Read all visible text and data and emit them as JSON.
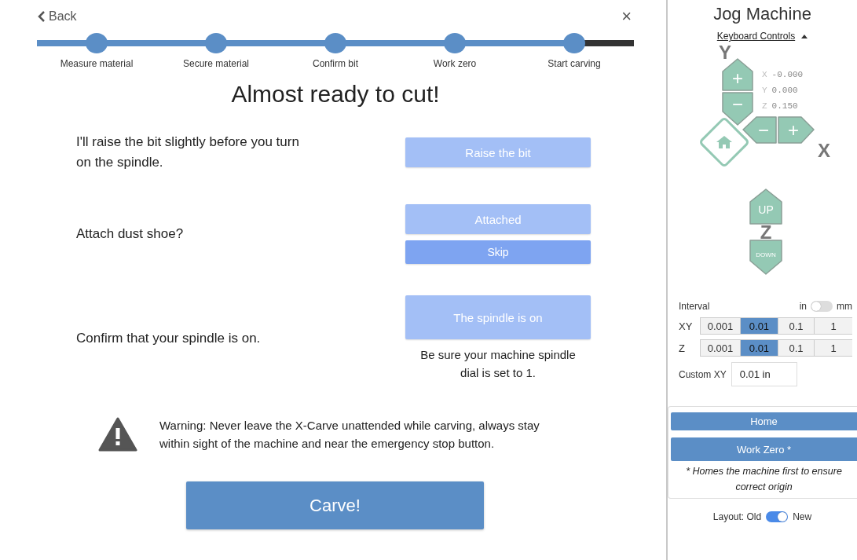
{
  "header": {
    "back": "Back",
    "close": "×"
  },
  "progress": {
    "level": 0.9
  },
  "steps": [
    {
      "label": "Measure material"
    },
    {
      "label": "Secure material"
    },
    {
      "label": "Confirm bit"
    },
    {
      "label": "Work zero"
    },
    {
      "label": "Start carving"
    }
  ],
  "title": "Almost ready to cut!",
  "tasks": [
    {
      "text": "I'll raise the bit slightly before you turn on the spindle.",
      "buttons": [
        {
          "label": "Raise the bit",
          "kind": "light"
        }
      ]
    },
    {
      "text": "Attach dust shoe?",
      "buttons": [
        {
          "label": "Attached",
          "kind": "light"
        },
        {
          "label": "Skip",
          "kind": "strong"
        }
      ]
    },
    {
      "text": "Confirm that your spindle is on.",
      "buttons": [
        {
          "label": "The spindle is on",
          "kind": "light"
        }
      ],
      "note": "Be sure your machine spindle dial is set to 1."
    }
  ],
  "warning": "Warning: Never leave the X-Carve unattended while carving, always stay within sight of the machine and near the emergency stop button.",
  "carve": "Carve!",
  "sidebar": {
    "title": "Jog Machine",
    "keyboard_controls": {
      "label": "Keyboard Controls",
      "expanded": true
    },
    "jog": {
      "axis_y": "Y",
      "y_buttons": [
        "+",
        "−"
      ],
      "x_buttons": [
        "−",
        "+"
      ],
      "axis_x": "X",
      "position": [
        {
          "axis": "X",
          "value": "-0.000"
        },
        {
          "axis": "Y",
          "value": "0.000"
        },
        {
          "axis": "Z",
          "value": "0.150"
        }
      ],
      "z_buttons": [
        "UP",
        "DOWN"
      ],
      "axis_z": "Z"
    },
    "interval": {
      "label": "Interval",
      "unit_left": "in",
      "unit_right": "mm",
      "on": false,
      "rows": [
        {
          "axis": "XY",
          "options": [
            {
              "label": "0.001",
              "selected": false
            },
            {
              "label": "0.01",
              "selected": true
            },
            {
              "label": "0.1",
              "selected": false
            },
            {
              "label": "1",
              "selected": false
            }
          ]
        },
        {
          "axis": "Z",
          "options": [
            {
              "label": "0.001",
              "selected": false
            },
            {
              "label": "0.01",
              "selected": true
            },
            {
              "label": "0.1",
              "selected": false
            },
            {
              "label": "1",
              "selected": false
            }
          ]
        }
      ]
    },
    "custom": {
      "label": "Custom XY",
      "value": "0.01 in"
    },
    "home": "Home",
    "work_zero": "Work Zero *",
    "footnote": "* Homes the machine first to ensure correct origin",
    "layout": {
      "label": "Layout: Old",
      "right": "New",
      "on": true
    }
  }
}
